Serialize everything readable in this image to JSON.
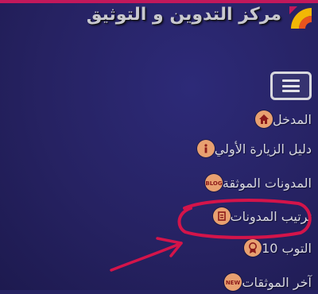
{
  "header": {
    "site_title": "مركز التدوين و التوثيق",
    "accent_color": "#c2185b"
  },
  "menu_button": {
    "icon": "hamburger-icon"
  },
  "nav": {
    "items": [
      {
        "label": "المدخل",
        "icon": "home-icon"
      },
      {
        "label": "دليل الزيارة الأولي",
        "icon": "info-icon"
      },
      {
        "label": "المدونات الموثقة",
        "icon": "blog-icon"
      },
      {
        "label": "ترتيب المدونات",
        "icon": "ranking-icon"
      },
      {
        "label": "التوب 10",
        "icon": "award-icon"
      },
      {
        "label": "آخر الموثقات",
        "icon": "new-icon"
      }
    ]
  },
  "colors": {
    "background": "#262262",
    "icon_bg": "#e8a070",
    "annotation": "#d4144a"
  }
}
